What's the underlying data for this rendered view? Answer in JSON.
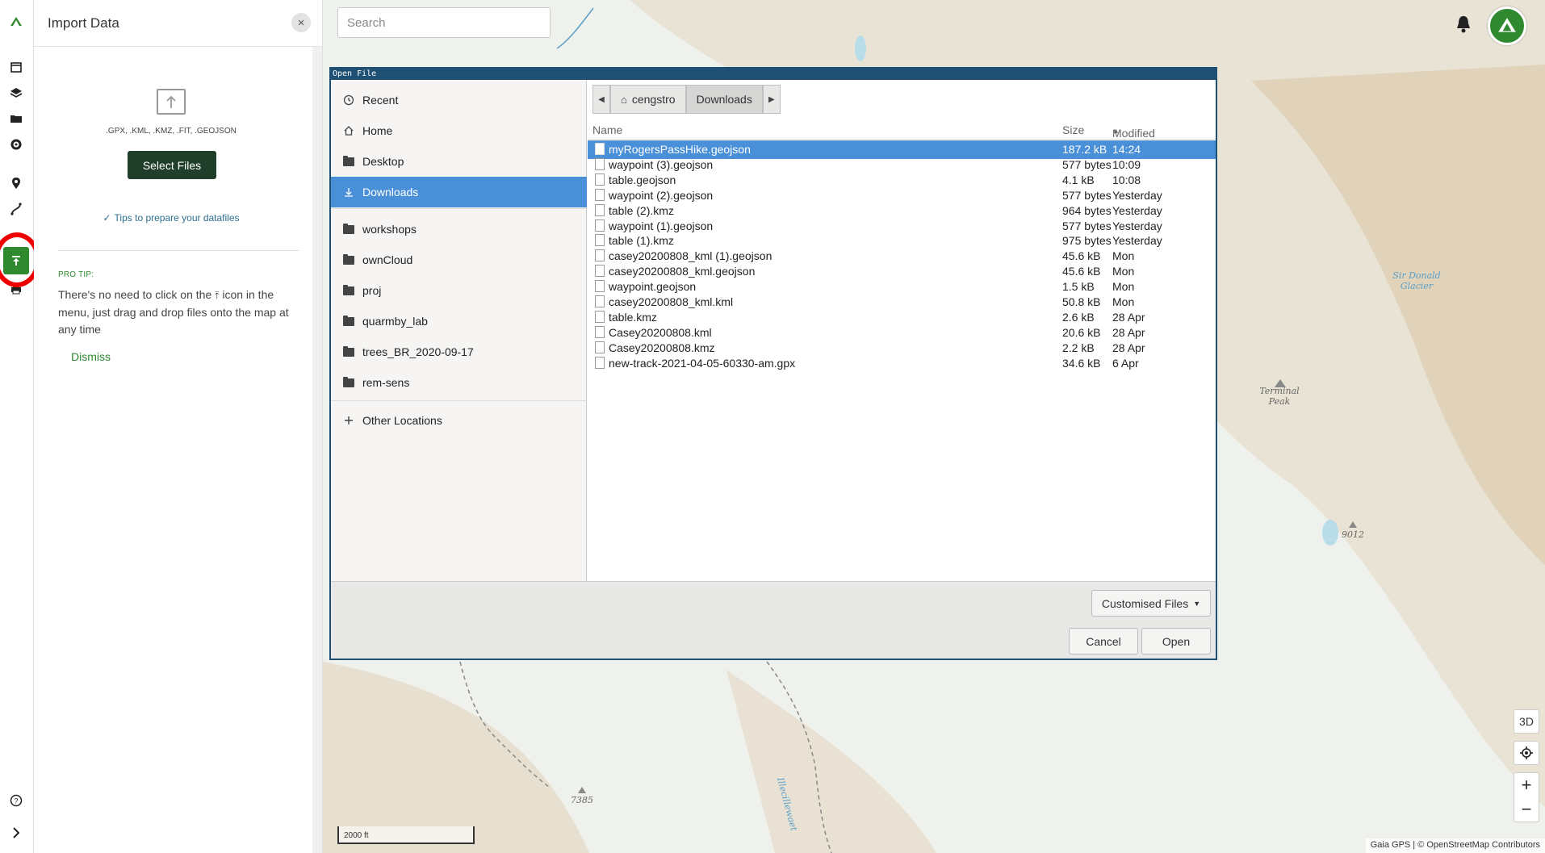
{
  "panel": {
    "title": "Import Data",
    "close_icon": "×",
    "formats": ".GPX, .KML, .KMZ, .FIT, .GEOJSON",
    "select_button": "Select Files",
    "tips_link": "Tips to prepare your datafiles",
    "protip_label": "PRO TIP:",
    "protip_text_before": "There's no need to click on the",
    "protip_text_after": "icon in the menu, just drag and drop files onto the map at any time",
    "dismiss": "Dismiss"
  },
  "search": {
    "placeholder": "Search"
  },
  "map": {
    "labels": [
      "Sir Donald Glacier",
      "Terminal Peak",
      "9012",
      "7385",
      "Illecillewaet"
    ],
    "scale": "2000 ft",
    "attribution": "Gaia GPS | © OpenStreetMap Contributors",
    "controls": {
      "three_d": "3D",
      "zoom_in": "+",
      "zoom_out": "−"
    }
  },
  "dialog": {
    "title": "Open File",
    "places": [
      {
        "label": "Recent",
        "icon": "clock-icon"
      },
      {
        "label": "Home",
        "icon": "home-icon"
      },
      {
        "label": "Desktop",
        "icon": "folder-icon"
      },
      {
        "label": "Downloads",
        "icon": "download-icon",
        "selected": true
      },
      {
        "label": "workshops",
        "icon": "folder-icon"
      },
      {
        "label": "ownCloud",
        "icon": "folder-icon"
      },
      {
        "label": "proj",
        "icon": "folder-icon"
      },
      {
        "label": "quarmby_lab",
        "icon": "folder-icon"
      },
      {
        "label": "trees_BR_2020-09-17",
        "icon": "folder-icon"
      },
      {
        "label": "rem-sens",
        "icon": "folder-icon"
      },
      {
        "label": "Other Locations",
        "icon": "plus-icon"
      }
    ],
    "path": [
      "cengstro",
      "Downloads"
    ],
    "columns": {
      "name": "Name",
      "size": "Size",
      "modified": "Modified"
    },
    "files": [
      {
        "name": "myRogersPassHike.geojson",
        "size": "187.2 kB",
        "modified": "14:24",
        "selected": true
      },
      {
        "name": "waypoint (3).geojson",
        "size": "577 bytes",
        "modified": "10:09"
      },
      {
        "name": "table.geojson",
        "size": "4.1 kB",
        "modified": "10:08"
      },
      {
        "name": "waypoint (2).geojson",
        "size": "577 bytes",
        "modified": "Yesterday"
      },
      {
        "name": "table (2).kmz",
        "size": "964 bytes",
        "modified": "Yesterday"
      },
      {
        "name": "waypoint (1).geojson",
        "size": "577 bytes",
        "modified": "Yesterday"
      },
      {
        "name": "table (1).kmz",
        "size": "975 bytes",
        "modified": "Yesterday"
      },
      {
        "name": "casey20200808_kml (1).geojson",
        "size": "45.6 kB",
        "modified": "Mon"
      },
      {
        "name": "casey20200808_kml.geojson",
        "size": "45.6 kB",
        "modified": "Mon"
      },
      {
        "name": "waypoint.geojson",
        "size": "1.5 kB",
        "modified": "Mon"
      },
      {
        "name": "casey20200808_kml.kml",
        "size": "50.8 kB",
        "modified": "Mon"
      },
      {
        "name": "table.kmz",
        "size": "2.6 kB",
        "modified": "28 Apr"
      },
      {
        "name": "Casey20200808.kml",
        "size": "20.6 kB",
        "modified": "28 Apr"
      },
      {
        "name": "Casey20200808.kmz",
        "size": "2.2 kB",
        "modified": "28 Apr"
      },
      {
        "name": "new-track-2021-04-05-60330-am.gpx",
        "size": "34.6 kB",
        "modified": "6 Apr"
      }
    ],
    "filter": "Customised Files",
    "cancel": "Cancel",
    "open": "Open"
  }
}
